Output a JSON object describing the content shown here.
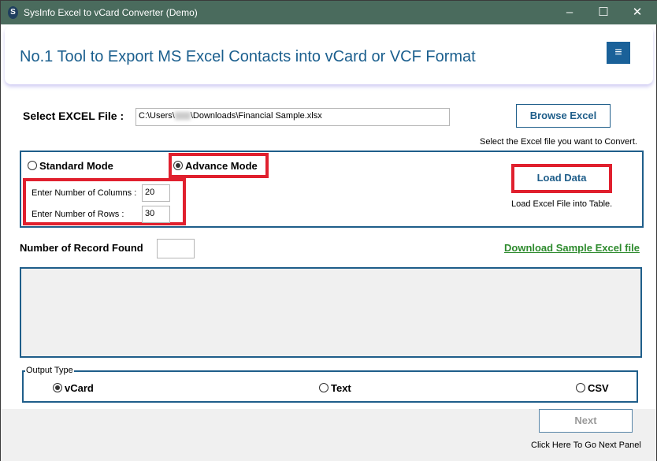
{
  "window": {
    "title": "SysInfo Excel to vCard Converter (Demo)",
    "logo_letter": "S",
    "minimize": "–",
    "maximize": "☐",
    "close": "✕"
  },
  "header": {
    "title": "No.1 Tool to Export MS Excel Contacts into vCard or VCF Format",
    "menu_icon": "≡"
  },
  "file": {
    "label": "Select EXCEL File :",
    "path_prefix": "C:\\Users\\",
    "path_suffix": "\\Downloads\\Financial Sample.xlsx",
    "browse_label": "Browse Excel",
    "hint": "Select the Excel file you want to Convert."
  },
  "mode": {
    "standard": "Standard Mode",
    "advance": "Advance Mode",
    "selected": "advance",
    "columns_label": "Enter Number of Columns :",
    "columns_value": "20",
    "rows_label": "Enter Number of Rows :",
    "rows_value": "30",
    "load_label": "Load Data",
    "load_hint": "Load Excel File into Table."
  },
  "records": {
    "label": "Number of Record Found",
    "value": "",
    "download_link": "Download Sample Excel file"
  },
  "output": {
    "legend": "Output Type",
    "options": [
      "vCard",
      "Text",
      "CSV"
    ],
    "selected": "vCard"
  },
  "footer": {
    "next_label": "Next",
    "next_hint": "Click Here To Go Next Panel"
  },
  "colors": {
    "accent": "#1f5e8a",
    "titlebar": "#4a6b5d",
    "highlight": "#e0202e",
    "link": "#2e8b2e"
  }
}
